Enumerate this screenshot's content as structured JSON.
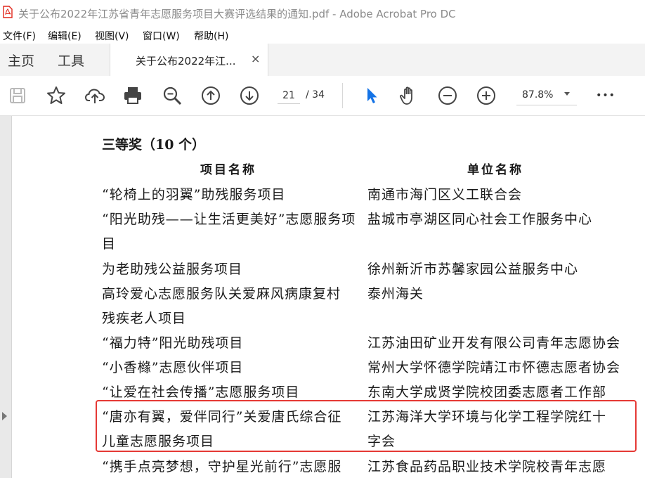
{
  "window": {
    "title": "关于公布2022年江苏省青年志愿服务项目大赛评选结果的通知.pdf - Adobe Acrobat Pro DC"
  },
  "menu": [
    "文件(F)",
    "编辑(E)",
    "视图(V)",
    "窗口(W)",
    "帮助(H)"
  ],
  "tabs": {
    "home": "主页",
    "tools": "工具",
    "document": "关于公布2022年江...",
    "close": "×"
  },
  "toolbar": {
    "current_page": "21",
    "total_pages": "/ 34",
    "zoom": "87.8%",
    "more": "•••"
  },
  "document": {
    "section_heading": "三等奖（10 个）",
    "col_project": "项目名称",
    "col_unit": "单位名称",
    "project_lines": [
      "“轮椅上的羽翼”助残服务项目",
      "“阳光助残——让生活更美好”志愿服务项",
      "目",
      "为老助残公益服务项目",
      "高玲爱心志愿服务队关爱麻风病康复村",
      "残疾老人项目",
      "“福力特”阳光助残项目",
      "“小香橼”志愿伙伴项目",
      "“让爱在社会传播”志愿服务项目",
      "“唐亦有翼，爱伴同行”关爱唐氏综合征",
      "儿童志愿服务项目",
      "“携手点亮梦想，守护星光前行”志愿服"
    ],
    "unit_lines": [
      "南通市海门区义工联合会",
      "盐城市亭湖区同心社会工作服务中心",
      "徐州新沂市苏馨家园公益服务中心",
      "泰州海关",
      "江苏油田矿业开发有限公司青年志愿协会",
      "常州大学怀德学院靖江市怀德志愿者协会",
      "东南大学成贤学院校团委志愿者工作部",
      "江苏海洋大学环境与化学工程学院红十",
      "字会",
      "江苏食品药品职业技术学院校青年志愿"
    ]
  },
  "colors": {
    "highlight": "#e53935",
    "cursor_blue": "#1473e6",
    "pdf_red": "#e0261b"
  }
}
